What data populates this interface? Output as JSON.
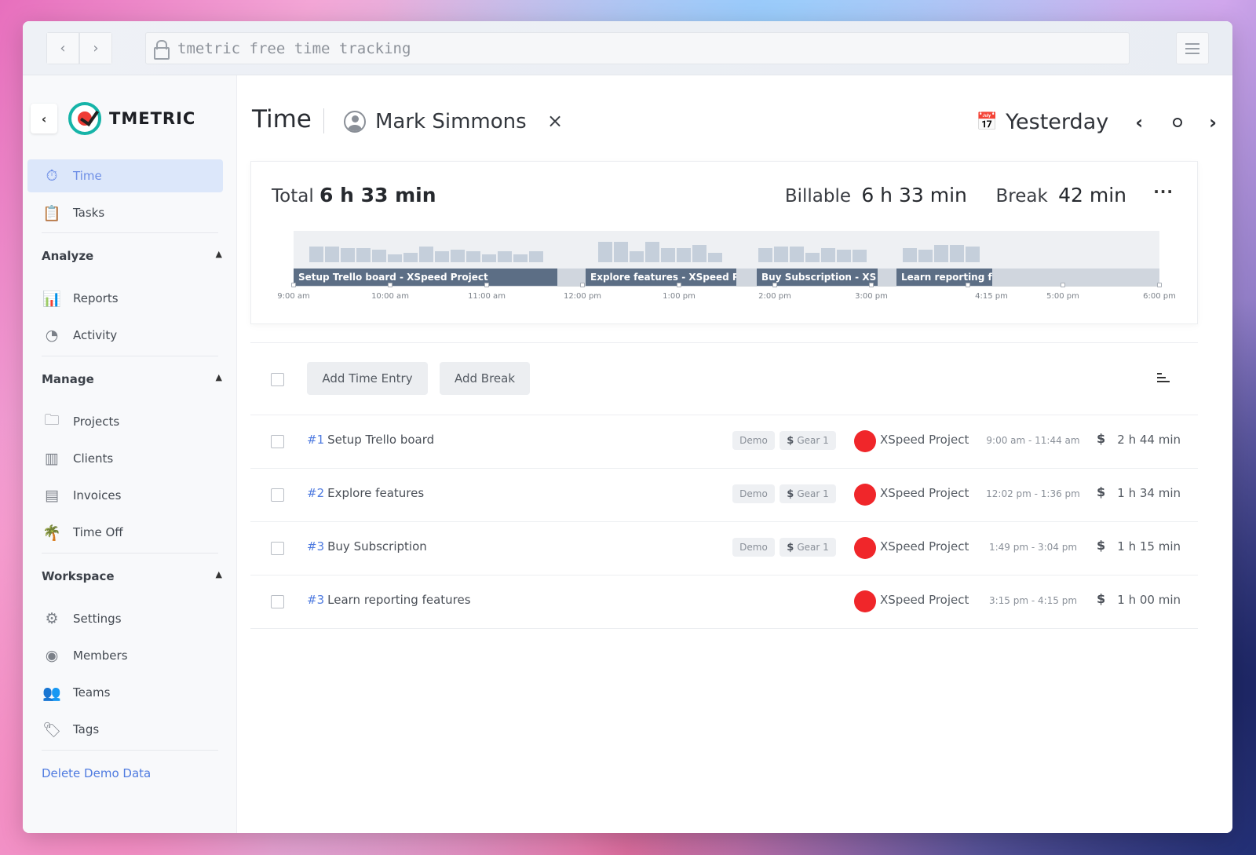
{
  "browser": {
    "url": "tmetric free time tracking",
    "back_label": "‹",
    "forward_label": "›"
  },
  "sidebar": {
    "brand": "TMETRIC",
    "nav": [
      {
        "label": "Time",
        "icon": "stopwatch-icon",
        "active": true
      },
      {
        "label": "Tasks",
        "icon": "clipboard-icon",
        "active": false
      }
    ],
    "sections": [
      {
        "title": "Analyze",
        "items": [
          {
            "label": "Reports",
            "icon": "bar-chart-icon"
          },
          {
            "label": "Activity",
            "icon": "activity-gauge-icon"
          }
        ]
      },
      {
        "title": "Manage",
        "items": [
          {
            "label": "Projects",
            "icon": "folder-icon"
          },
          {
            "label": "Clients",
            "icon": "building-icon"
          },
          {
            "label": "Invoices",
            "icon": "invoice-icon"
          },
          {
            "label": "Time Off",
            "icon": "palm-tree-icon"
          }
        ]
      },
      {
        "title": "Workspace",
        "items": [
          {
            "label": "Settings",
            "icon": "gear-icon"
          },
          {
            "label": "Members",
            "icon": "member-icon"
          },
          {
            "label": "Teams",
            "icon": "team-icon"
          },
          {
            "label": "Tags",
            "icon": "tag-icon"
          }
        ]
      }
    ],
    "footer_link": "Delete Demo Data"
  },
  "header": {
    "title": "Time",
    "user": "Mark Simmons",
    "remove_label": "×",
    "date": "Yesterday"
  },
  "summary": {
    "total_label": "Total",
    "total_value": "6 h 33 min",
    "billable_label": "Billable",
    "billable_value": "6 h 33 min",
    "break_label": "Break",
    "break_value": "42 min",
    "more_label": "···"
  },
  "timeline": {
    "segments": [
      {
        "label": "Setup Trello board - XSpeed Project"
      },
      {
        "label": "Explore features - XSpeed Pr"
      },
      {
        "label": "Buy Subscription - XS"
      },
      {
        "label": "Learn reporting fe"
      }
    ],
    "labels": [
      "9:00 am",
      "10:00 am",
      "11:00 am",
      "12:00 pm",
      "1:00 pm",
      "2:00 pm",
      "3:00 pm",
      "4:15 pm",
      "5:00 pm",
      "6:00 pm"
    ]
  },
  "toolbar": {
    "add_entry": "Add Time Entry",
    "add_break": "Add Break"
  },
  "entries": [
    {
      "num": "#1",
      "name": "Setup Trello board",
      "tags": [
        "Demo",
        "Gear 1"
      ],
      "project": "XSpeed Project",
      "range": "9:00 am - 11:44 am",
      "billable": "$",
      "duration": "2 h 44 min"
    },
    {
      "num": "#2",
      "name": "Explore features",
      "tags": [
        "Demo",
        "Gear 1"
      ],
      "project": "XSpeed Project",
      "range": "12:02 pm - 1:36 pm",
      "billable": "$",
      "duration": "1 h 34 min"
    },
    {
      "num": "#3",
      "name": "Buy Subscription",
      "tags": [
        "Demo",
        "Gear 1"
      ],
      "project": "XSpeed Project",
      "range": "1:49 pm - 3:04 pm",
      "billable": "$",
      "duration": "1 h 15 min"
    },
    {
      "num": "#3",
      "name": "Learn reporting features",
      "tags": [],
      "project": "XSpeed Project",
      "range": "3:15 pm - 4:15 pm",
      "billable": "$",
      "duration": "1 h 00 min"
    }
  ],
  "colors": {
    "accent": "#4f7be0",
    "project": "#f0262a",
    "active_nav_bg": "#dce7fa"
  }
}
